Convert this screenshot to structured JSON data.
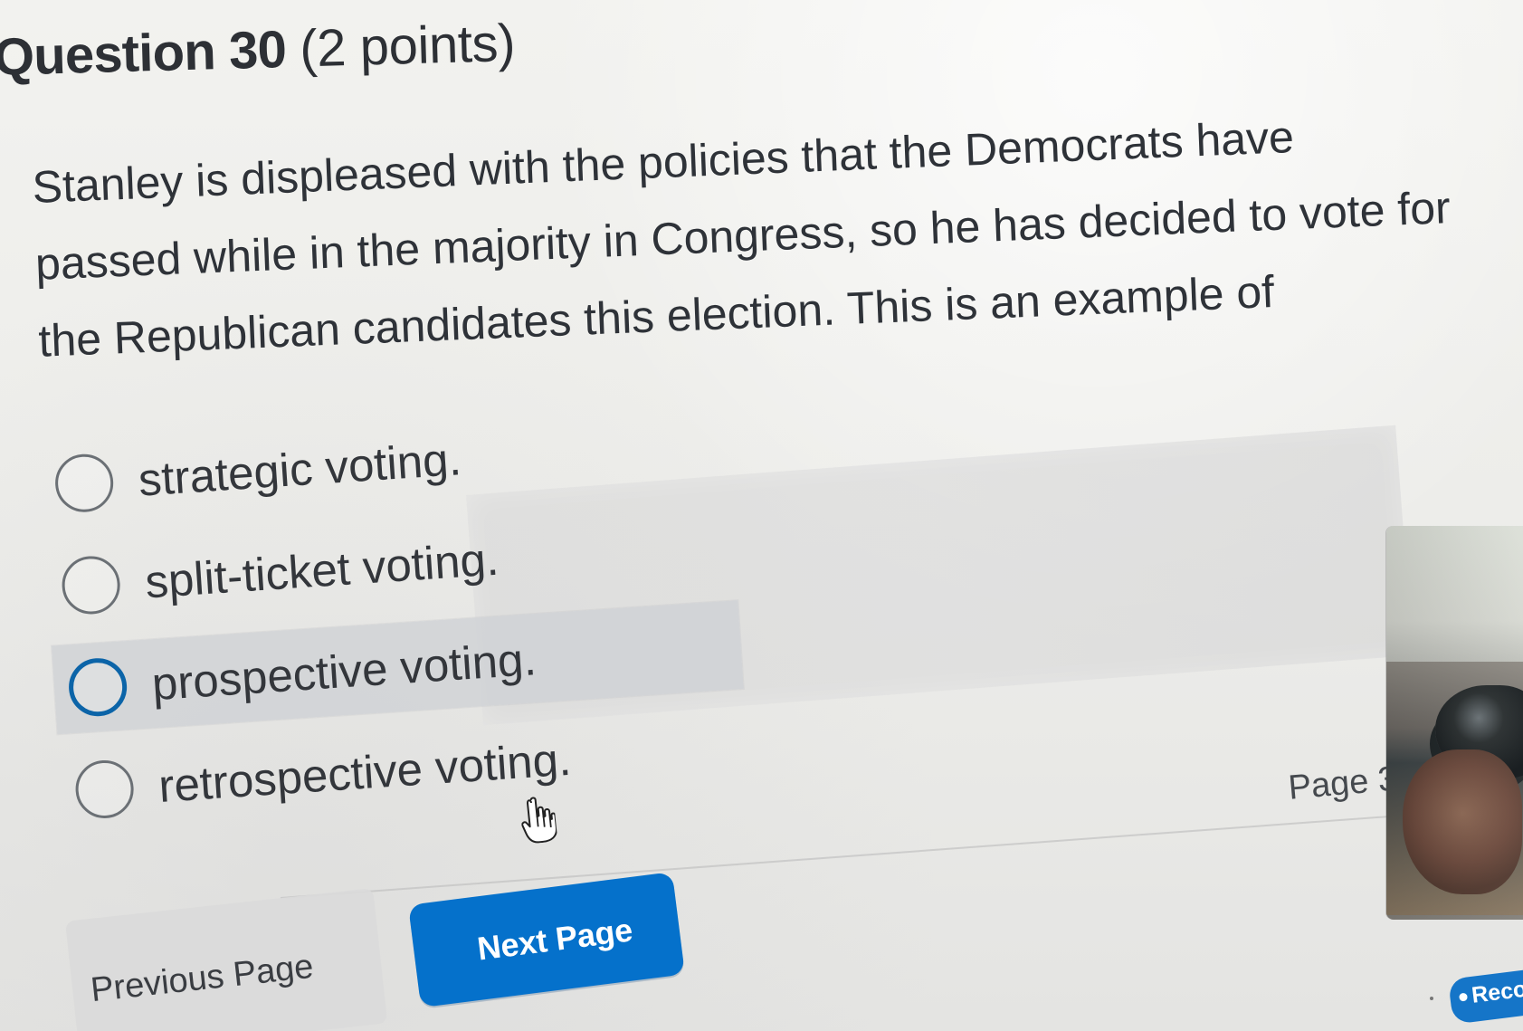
{
  "question": {
    "title": "Question 30",
    "points": "(2 points)",
    "text": "Stanley is displeased with the policies that the Democrats have passed while in the majority in Congress, so he has decided to vote for the Republican candidates this election. This is an example of"
  },
  "options": [
    {
      "label": "strategic voting.",
      "state": "default"
    },
    {
      "label": "split-ticket voting.",
      "state": "default"
    },
    {
      "label": "prospective voting.",
      "state": "hovered"
    },
    {
      "label": "retrospective voting.",
      "state": "default"
    }
  ],
  "pagination": {
    "page_indicator": "Page 3",
    "previous_label": "Previous Page",
    "next_label": "Next Page"
  },
  "recording": {
    "label": "Reco"
  },
  "icons": {
    "cursor": "hand-pointer-icon",
    "record": "record-dot-icon"
  },
  "colors": {
    "accent": "#0571cb",
    "selected_radio": "#0b64a8",
    "text": "#2e3238",
    "hover_band": "#d0d2d5"
  }
}
